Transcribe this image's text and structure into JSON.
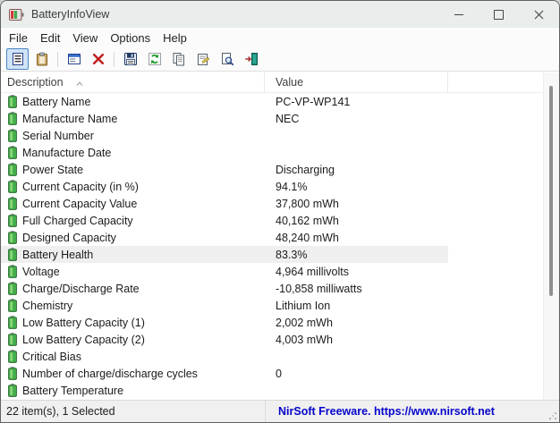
{
  "window": {
    "title": "BatteryInfoView"
  },
  "menu": {
    "items": [
      "File",
      "Edit",
      "View",
      "Options",
      "Help"
    ]
  },
  "toolbar": {
    "buttons": [
      {
        "name": "report-view",
        "selected": true
      },
      {
        "name": "clipboard",
        "selected": false
      },
      {
        "name": "choose-columns",
        "selected": false
      },
      {
        "name": "delete",
        "selected": false
      },
      {
        "name": "save",
        "selected": false
      },
      {
        "name": "refresh",
        "selected": false
      },
      {
        "name": "copy",
        "selected": false
      },
      {
        "name": "properties",
        "selected": false
      },
      {
        "name": "find",
        "selected": false
      },
      {
        "name": "exit",
        "selected": false
      }
    ]
  },
  "list": {
    "columns": [
      "Description",
      "Value"
    ],
    "sort_column": "Description",
    "rows": [
      {
        "description": "Battery Name",
        "value": "PC-VP-WP141"
      },
      {
        "description": "Manufacture Name",
        "value": "NEC"
      },
      {
        "description": "Serial Number",
        "value": ""
      },
      {
        "description": "Manufacture Date",
        "value": ""
      },
      {
        "description": "Power State",
        "value": "Discharging"
      },
      {
        "description": "Current Capacity (in %)",
        "value": "94.1%"
      },
      {
        "description": "Current Capacity Value",
        "value": "37,800 mWh"
      },
      {
        "description": "Full Charged Capacity",
        "value": "40,162 mWh"
      },
      {
        "description": "Designed Capacity",
        "value": "48,240 mWh"
      },
      {
        "description": "Battery Health",
        "value": "83.3%",
        "selected": true
      },
      {
        "description": "Voltage",
        "value": "4,964 millivolts"
      },
      {
        "description": "Charge/Discharge Rate",
        "value": "-10,858 milliwatts"
      },
      {
        "description": "Chemistry",
        "value": "Lithium Ion"
      },
      {
        "description": "Low Battery Capacity (1)",
        "value": "2,002 mWh"
      },
      {
        "description": "Low Battery Capacity (2)",
        "value": "4,003 mWh"
      },
      {
        "description": "Critical Bias",
        "value": ""
      },
      {
        "description": "Number of charge/discharge cycles",
        "value": "0"
      },
      {
        "description": "Battery Temperature",
        "value": ""
      }
    ]
  },
  "statusbar": {
    "items_text": "22 item(s), 1 Selected",
    "freeware_text": "NirSoft Freeware. https://www.nirsoft.net"
  },
  "colors": {
    "titlebar_bg": "#e9edec",
    "selection_bg": "#efefef",
    "toolbar_selected_bg": "#cfe4f7",
    "toolbar_selected_border": "#4a84c0",
    "battery_green": "#45b04c",
    "link_blue": "#0404cc"
  }
}
